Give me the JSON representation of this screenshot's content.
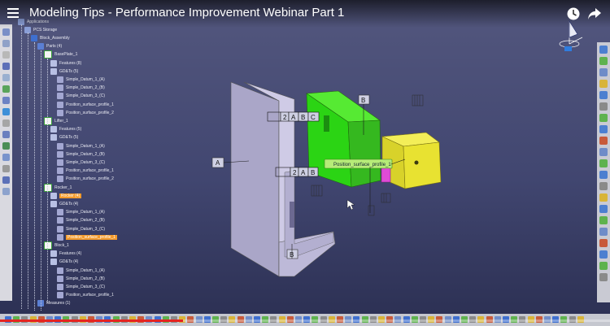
{
  "video": {
    "title": "Modeling Tips - Performance Improvement Webinar Part 1",
    "progress_pct": 30
  },
  "tree": {
    "nodes": [
      {
        "label": "Applications",
        "depth": 0
      },
      {
        "label": "PCS Storage",
        "depth": 1
      },
      {
        "label": "Block_Assembly",
        "depth": 2
      },
      {
        "label": "Parts (4)",
        "depth": 3
      },
      {
        "label": "BasePlate_1",
        "depth": 4
      },
      {
        "label": "Features (8)",
        "depth": 5
      },
      {
        "label": "GD&Ts (5)",
        "depth": 5
      },
      {
        "label": "Simple_Datum_1_(A)",
        "depth": 6
      },
      {
        "label": "Simple_Datum_2_(B)",
        "depth": 6
      },
      {
        "label": "Simple_Datum_3_(C)",
        "depth": 6
      },
      {
        "label": "Position_surface_profile_1",
        "depth": 6
      },
      {
        "label": "Position_surface_profile_2",
        "depth": 6
      },
      {
        "label": "Lifter_1",
        "depth": 4
      },
      {
        "label": "Features (5)",
        "depth": 5
      },
      {
        "label": "GD&Ts (5)",
        "depth": 5
      },
      {
        "label": "Simple_Datum_1_(A)",
        "depth": 6
      },
      {
        "label": "Simple_Datum_2_(B)",
        "depth": 6
      },
      {
        "label": "Simple_Datum_3_(C)",
        "depth": 6
      },
      {
        "label": "Position_surface_profile_1",
        "depth": 6
      },
      {
        "label": "Position_surface_profile_2",
        "depth": 6
      },
      {
        "label": "Rocker_1",
        "depth": 4
      },
      {
        "label": "Rocker (4)",
        "depth": 5,
        "selected": true
      },
      {
        "label": "GD&Ts (4)",
        "depth": 5
      },
      {
        "label": "Simple_Datum_1_(A)",
        "depth": 6
      },
      {
        "label": "Simple_Datum_2_(B)",
        "depth": 6
      },
      {
        "label": "Simple_Datum_3_(C)",
        "depth": 6
      },
      {
        "label": "Position_surface_profile_1",
        "depth": 6,
        "selected": true
      },
      {
        "label": "Block_1",
        "depth": 4
      },
      {
        "label": "Features (4)",
        "depth": 5
      },
      {
        "label": "GD&Ts (4)",
        "depth": 5
      },
      {
        "label": "Simple_Datum_1_(A)",
        "depth": 6
      },
      {
        "label": "Simple_Datum_2_(B)",
        "depth": 6
      },
      {
        "label": "Simple_Datum_3_(C)",
        "depth": 6
      },
      {
        "label": "Position_surface_profile_1",
        "depth": 6
      },
      {
        "label": "Measures (1)",
        "depth": 3
      }
    ]
  },
  "scene": {
    "datum_a": "A",
    "datum_b": "B",
    "datum_c": "C",
    "datum_num_2": "2",
    "annotation_label": "Position_surface_profile_1"
  },
  "colors": {
    "green_part": "#2bd414",
    "yellow_part": "#e8e231",
    "base_part": "#c7c3de",
    "accent_orange": "#f39a2c",
    "progress_red": "#e52421"
  }
}
